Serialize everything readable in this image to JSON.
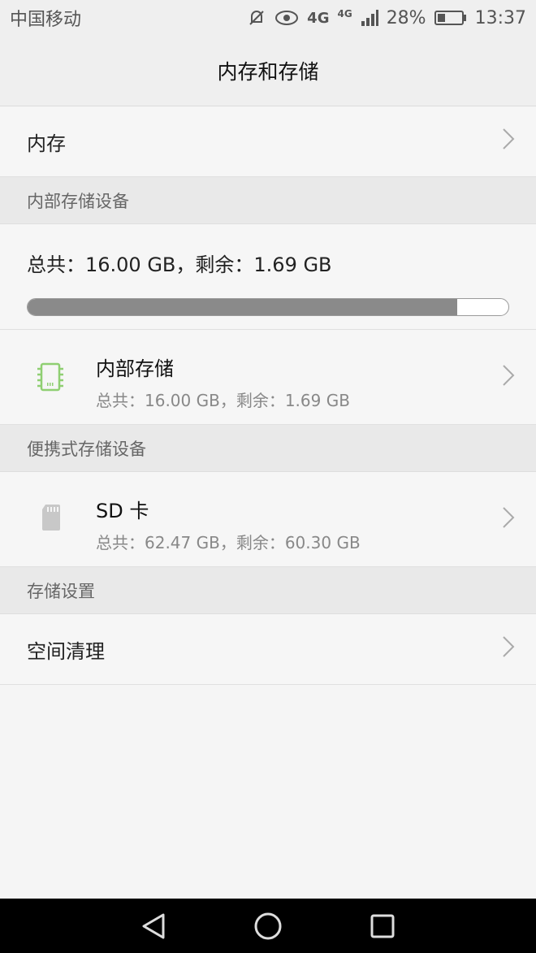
{
  "status": {
    "carrier": "中国移动",
    "network1": "4G",
    "network2": "4G",
    "battery": "28%",
    "time": "13:37"
  },
  "appbar": {
    "title": "内存和存储"
  },
  "memory_row": {
    "label": "内存"
  },
  "internal_section": {
    "header": "内部存储设备",
    "summary": "总共：16.00 GB，剩余：1.69 GB",
    "used_fraction": 0.894,
    "item": {
      "title": "内部存储",
      "subtitle": "总共：16.00 GB，剩余：1.69 GB"
    }
  },
  "portable_section": {
    "header": "便携式存储设备",
    "item": {
      "title": "SD 卡",
      "subtitle": "总共：62.47 GB，剩余：60.30 GB"
    }
  },
  "settings_section": {
    "header": "存储设置",
    "item": {
      "label": "空间清理"
    }
  },
  "colors": {
    "accent_green": "#8fcf72",
    "progress_fill": "#8a8a8a"
  },
  "icons": [
    "mute-icon",
    "eye-icon",
    "signal-icon",
    "battery-icon",
    "chevron-right-icon",
    "chip-icon",
    "sd-card-icon",
    "back-icon",
    "home-icon",
    "recents-icon"
  ]
}
